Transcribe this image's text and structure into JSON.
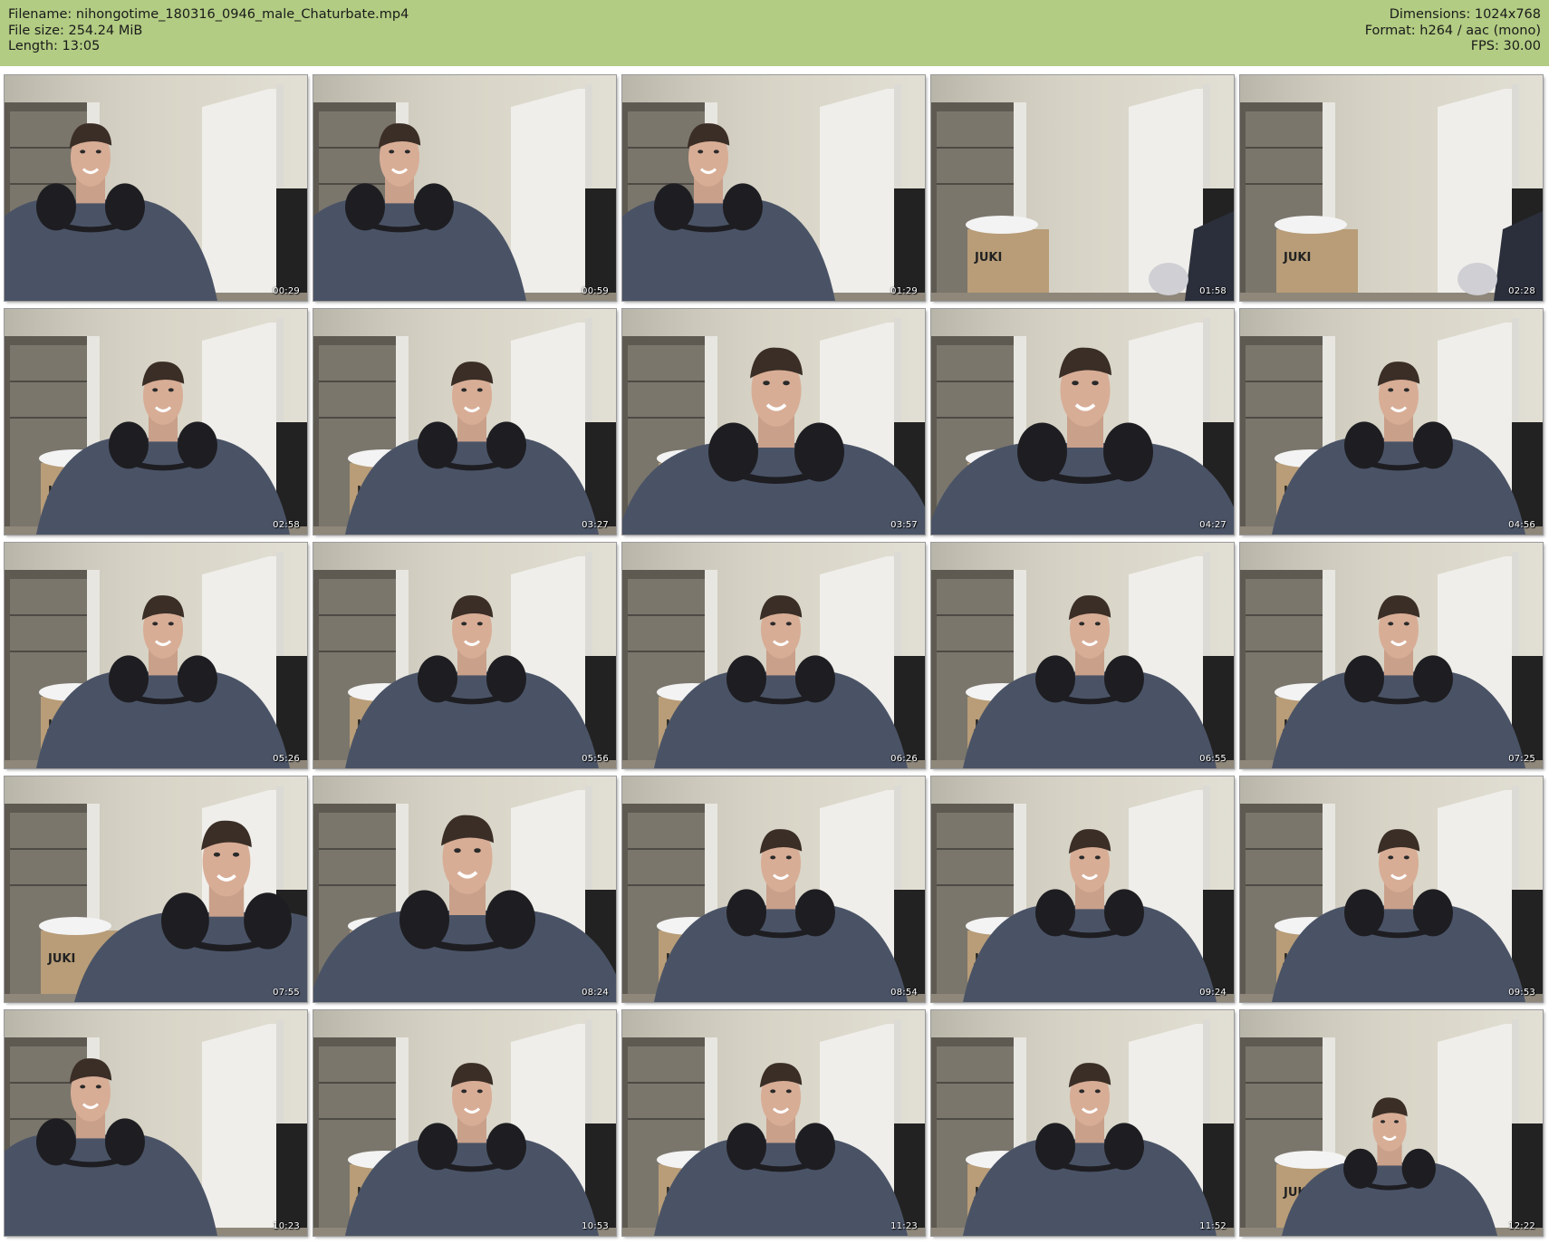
{
  "header": {
    "filename": "Filename: nihongotime_180316_0946_male_Chaturbate.mp4",
    "filesize": "File size: 254.24 MiB",
    "length": "Length: 13:05",
    "dimensions": "Dimensions: 1024x768",
    "format": "Format: h264 / aac (mono)",
    "fps": "FPS: 30.00"
  },
  "colors": {
    "header_bg": "#b2cc83",
    "wall": "#d8d4c6",
    "sweater": "#4a5366",
    "headset": "#1e1e22",
    "box": "#b89d78"
  },
  "box_label": "JUKI",
  "thumbnails": [
    {
      "time": "00:29",
      "scene": "person-left"
    },
    {
      "time": "00:59",
      "scene": "person-left"
    },
    {
      "time": "01:29",
      "scene": "person-left"
    },
    {
      "time": "01:58",
      "scene": "empty-room"
    },
    {
      "time": "02:28",
      "scene": "empty-room"
    },
    {
      "time": "02:58",
      "scene": "person-center"
    },
    {
      "time": "03:27",
      "scene": "person-center"
    },
    {
      "time": "03:57",
      "scene": "person-close"
    },
    {
      "time": "04:27",
      "scene": "person-close"
    },
    {
      "time": "04:56",
      "scene": "person-center"
    },
    {
      "time": "05:26",
      "scene": "person-center"
    },
    {
      "time": "05:56",
      "scene": "person-center"
    },
    {
      "time": "06:26",
      "scene": "person-center"
    },
    {
      "time": "06:55",
      "scene": "person-center"
    },
    {
      "time": "07:25",
      "scene": "person-center"
    },
    {
      "time": "07:55",
      "scene": "person-lean"
    },
    {
      "time": "08:24",
      "scene": "person-close"
    },
    {
      "time": "08:54",
      "scene": "person-center"
    },
    {
      "time": "09:24",
      "scene": "person-center"
    },
    {
      "time": "09:53",
      "scene": "person-center"
    },
    {
      "time": "10:23",
      "scene": "person-left"
    },
    {
      "time": "10:53",
      "scene": "person-center"
    },
    {
      "time": "11:23",
      "scene": "person-center"
    },
    {
      "time": "11:52",
      "scene": "person-center"
    },
    {
      "time": "12:22",
      "scene": "person-far"
    }
  ]
}
